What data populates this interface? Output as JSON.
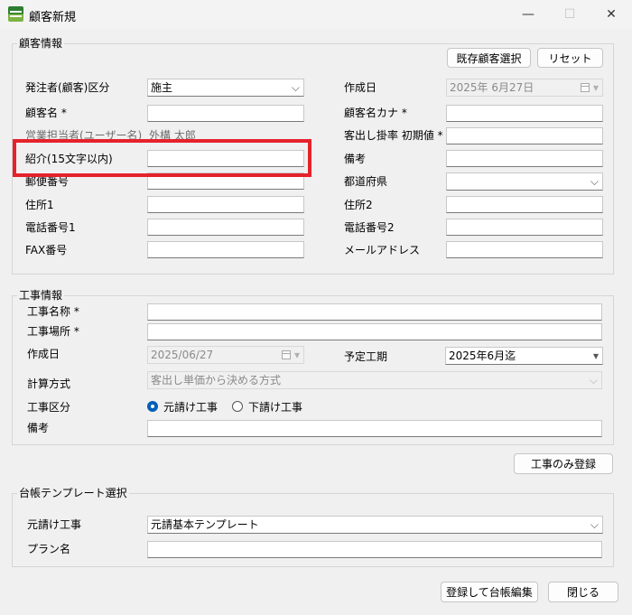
{
  "window": {
    "title": "顧客新規",
    "minimize": "—",
    "maximize": "☐",
    "close": "✕"
  },
  "customer": {
    "group_title": "顧客情報",
    "btn_existing": "既存顧客選択",
    "btn_reset": "リセット",
    "orderer_type_label": "発注者(顧客)区分",
    "orderer_type_value": "施主",
    "created_label": "作成日",
    "created_value": "2025年 6月27日",
    "name_label": "顧客名 *",
    "kana_label": "顧客名カナ *",
    "sales_label": "営業担当者(ユーザー名)",
    "sales_value": "外構 太郎",
    "rate_label": "客出し掛率 初期値 *",
    "intro_label": "紹介(15文字以内)",
    "remarks_label": "備考",
    "zip_label": "郵便番号",
    "pref_label": "都道府県",
    "addr1_label": "住所1",
    "addr2_label": "住所2",
    "tel1_label": "電話番号1",
    "tel2_label": "電話番号2",
    "fax_label": "FAX番号",
    "mail_label": "メールアドレス"
  },
  "construction": {
    "group_title": "工事情報",
    "name_label": "工事名称 *",
    "place_label": "工事場所 *",
    "created_label": "作成日",
    "created_value": "2025/06/27",
    "period_label": "予定工期",
    "period_value": "2025年6月迄",
    "calc_label": "計算方式",
    "calc_value": "客出し単価から決める方式",
    "type_label": "工事区分",
    "type_opt1": "元請け工事",
    "type_opt2": "下請け工事",
    "type_selected": "元請け工事",
    "remarks_label": "備考",
    "btn_register_only": "工事のみ登録"
  },
  "template": {
    "group_title": "台帳テンプレート選択",
    "main_label": "元請け工事",
    "main_value": "元請基本テンプレート",
    "plan_label": "プラン名"
  },
  "footer": {
    "btn_register_edit": "登録して台帳編集",
    "btn_close": "閉じる"
  },
  "colors": {
    "highlight": "#e5222b",
    "radio_accent": "#005fb8"
  }
}
